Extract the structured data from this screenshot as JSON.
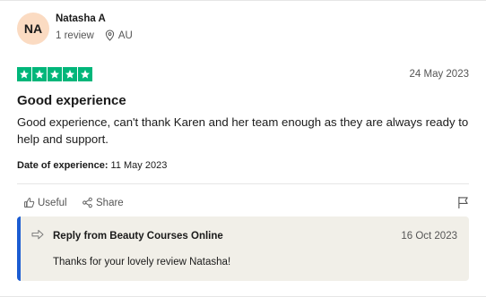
{
  "reviewer": {
    "initials": "NA",
    "name": "Natasha A",
    "review_count": "1 review",
    "country": "AU"
  },
  "review": {
    "rating": 5,
    "date": "24 May 2023",
    "title": "Good experience",
    "body": "Good experience, can't thank Karen and her team enough as they are always ready to help and support.",
    "experience_label": "Date of experience:",
    "experience_date": "11 May 2023"
  },
  "actions": {
    "useful_label": "Useful",
    "share_label": "Share"
  },
  "reply": {
    "from": "Reply from Beauty Courses Online",
    "date": "16 Oct 2023",
    "text": "Thanks for your lovely review Natasha!"
  },
  "colors": {
    "star_green": "#00b67a",
    "avatar_bg": "#fbdbc2",
    "reply_bg": "#f1efe8",
    "reply_accent": "#1c5dd2"
  },
  "icons": [
    "location-pin-icon",
    "star-icon",
    "thumbs-up-icon",
    "share-icon",
    "flag-icon",
    "reply-arrow-icon"
  ]
}
